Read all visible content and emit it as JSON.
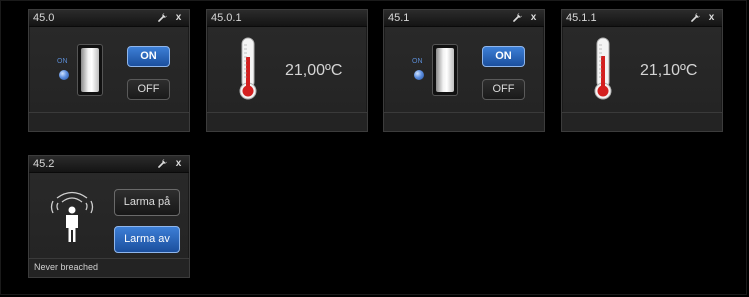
{
  "widgets": {
    "w1": {
      "title": "45.0",
      "on_indicator": "ON",
      "on_button": "ON",
      "off_button": "OFF",
      "state": "off"
    },
    "w2": {
      "title": "45.0.1",
      "temperature": "21,00ºC"
    },
    "w3": {
      "title": "45.1",
      "on_indicator": "ON",
      "on_button": "ON",
      "off_button": "OFF",
      "state": "off"
    },
    "w4": {
      "title": "45.1.1",
      "temperature": "21,10ºC"
    },
    "w5": {
      "title": "45.2",
      "arm_button": "Larma på",
      "disarm_button": "Larma av",
      "status": "Never breached"
    }
  },
  "titlebar_icons": {
    "settings": "wrench-icon",
    "close": "close-icon",
    "close_glyph": "x"
  },
  "colors": {
    "background": "#000000",
    "widget": "#252525",
    "accent_blue": "#2a66bb",
    "thermo_red": "#d42020"
  }
}
